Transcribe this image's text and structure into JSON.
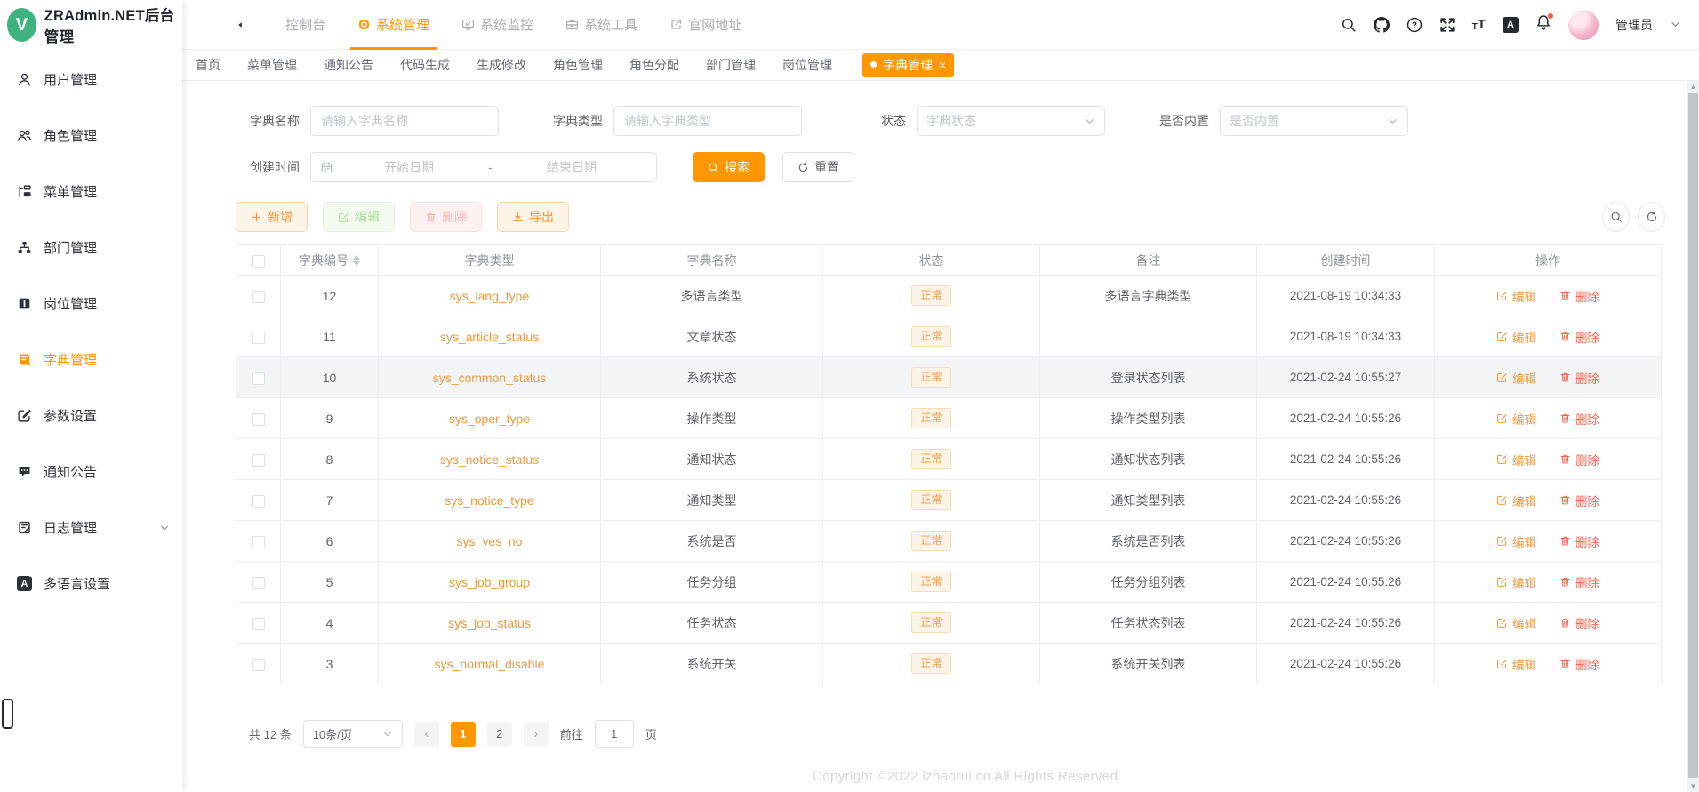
{
  "window": {
    "title": "ZRAdmin.NET后台管理",
    "logo_letter": "V"
  },
  "header": {
    "nav": [
      {
        "label": "控制台",
        "icon": "",
        "active": false
      },
      {
        "label": "系统管理",
        "icon": "gear-icon",
        "active": true
      },
      {
        "label": "系统监控",
        "icon": "monitor-icon",
        "active": false
      },
      {
        "label": "系统工具",
        "icon": "toolbox-icon",
        "active": false
      },
      {
        "label": "官网地址",
        "icon": "external-link-icon",
        "active": false
      }
    ],
    "icons": [
      {
        "name": "search-icon"
      },
      {
        "name": "github-icon"
      },
      {
        "name": "help-icon"
      },
      {
        "name": "fullscreen-icon"
      },
      {
        "name": "font-size-icon"
      },
      {
        "name": "translate-icon"
      },
      {
        "name": "bell-icon",
        "badge": true
      }
    ],
    "user": {
      "name": "管理员"
    }
  },
  "tabbar": {
    "tabs": [
      "首页",
      "菜单管理",
      "通知公告",
      "代码生成",
      "生成修改",
      "角色管理",
      "角色分配",
      "部门管理",
      "岗位管理"
    ],
    "active": {
      "label": "字典管理",
      "close": "×"
    }
  },
  "sidebar": {
    "items": [
      {
        "label": "用户管理",
        "icon": "user-icon",
        "active": false,
        "has_children": false
      },
      {
        "label": "角色管理",
        "icon": "roles-icon",
        "active": false,
        "has_children": false
      },
      {
        "label": "菜单管理",
        "icon": "menu-tree-icon",
        "active": false,
        "has_children": false
      },
      {
        "label": "部门管理",
        "icon": "org-icon",
        "active": false,
        "has_children": false
      },
      {
        "label": "岗位管理",
        "icon": "post-icon",
        "active": false,
        "has_children": false
      },
      {
        "label": "字典管理",
        "icon": "dict-icon",
        "active": true,
        "has_children": false
      },
      {
        "label": "参数设置",
        "icon": "param-icon",
        "active": false,
        "has_children": false
      },
      {
        "label": "通知公告",
        "icon": "notice-icon",
        "active": false,
        "has_children": false
      },
      {
        "label": "日志管理",
        "icon": "log-icon",
        "active": false,
        "has_children": true
      },
      {
        "label": "多语言设置",
        "icon": "translate-icon",
        "active": false,
        "has_children": false
      }
    ]
  },
  "filters": {
    "dict_name": {
      "label": "字典名称",
      "placeholder": "请输入字典名称"
    },
    "dict_type": {
      "label": "字典类型",
      "placeholder": "请输入字典类型"
    },
    "status": {
      "label": "状态",
      "placeholder": "字典状态"
    },
    "builtin": {
      "label": "是否内置",
      "placeholder": "是否内置"
    },
    "create_time": {
      "label": "创建时间",
      "start_placeholder": "开始日期",
      "separator": "-",
      "end_placeholder": "结束日期"
    },
    "search_label": "搜索",
    "reset_label": "重置"
  },
  "toolbar": {
    "add_label": "新增",
    "edit_label": "编辑",
    "delete_label": "删除",
    "export_label": "导出"
  },
  "table": {
    "columns": [
      "",
      "字典编号",
      "字典类型",
      "字典名称",
      "状态",
      "备注",
      "创建时间",
      "操作"
    ],
    "edit_label": "编辑",
    "delete_label": "删除",
    "rows": [
      {
        "id": "12",
        "type": "sys_lang_type",
        "name": "多语言类型",
        "status": "正常",
        "remark": "多语言字典类型",
        "created": "2021-08-19 10:34:33",
        "highlight": false
      },
      {
        "id": "11",
        "type": "sys_article_status",
        "name": "文章状态",
        "status": "正常",
        "remark": "",
        "created": "2021-08-19 10:34:33",
        "highlight": false
      },
      {
        "id": "10",
        "type": "sys_common_status",
        "name": "系统状态",
        "status": "正常",
        "remark": "登录状态列表",
        "created": "2021-02-24 10:55:27",
        "highlight": true
      },
      {
        "id": "9",
        "type": "sys_oper_type",
        "name": "操作类型",
        "status": "正常",
        "remark": "操作类型列表",
        "created": "2021-02-24 10:55:26",
        "highlight": false
      },
      {
        "id": "8",
        "type": "sys_notice_status",
        "name": "通知状态",
        "status": "正常",
        "remark": "通知状态列表",
        "created": "2021-02-24 10:55:26",
        "highlight": false
      },
      {
        "id": "7",
        "type": "sys_notice_type",
        "name": "通知类型",
        "status": "正常",
        "remark": "通知类型列表",
        "created": "2021-02-24 10:55:26",
        "highlight": false
      },
      {
        "id": "6",
        "type": "sys_yes_no",
        "name": "系统是否",
        "status": "正常",
        "remark": "系统是否列表",
        "created": "2021-02-24 10:55:26",
        "highlight": false
      },
      {
        "id": "5",
        "type": "sys_job_group",
        "name": "任务分组",
        "status": "正常",
        "remark": "任务分组列表",
        "created": "2021-02-24 10:55:26",
        "highlight": false
      },
      {
        "id": "4",
        "type": "sys_job_status",
        "name": "任务状态",
        "status": "正常",
        "remark": "任务状态列表",
        "created": "2021-02-24 10:55:26",
        "highlight": false
      },
      {
        "id": "3",
        "type": "sys_normal_disable",
        "name": "系统开关",
        "status": "正常",
        "remark": "系统开关列表",
        "created": "2021-02-24 10:55:26",
        "highlight": false
      }
    ]
  },
  "pagination": {
    "total_label": "共 12 条",
    "page_size": "10条/页",
    "prev_glyph": "‹",
    "next_glyph": "›",
    "pages": [
      "1",
      "2"
    ],
    "active_page": "1",
    "goto_label": "前往",
    "goto_value": "1",
    "unit_label": "页"
  },
  "footer": {
    "copyright": "Copyright ©2022 izhaorui.cn All Rights Reserved."
  },
  "colors": {
    "primary": "#ff9700",
    "logo_green": "#3eb37f",
    "tag_text": "#f2993f",
    "tag_bg": "#fdf3e6",
    "tag_border": "#f9ddb0",
    "delete_red": "#f5654e",
    "notification_dot": "#f5583b"
  }
}
